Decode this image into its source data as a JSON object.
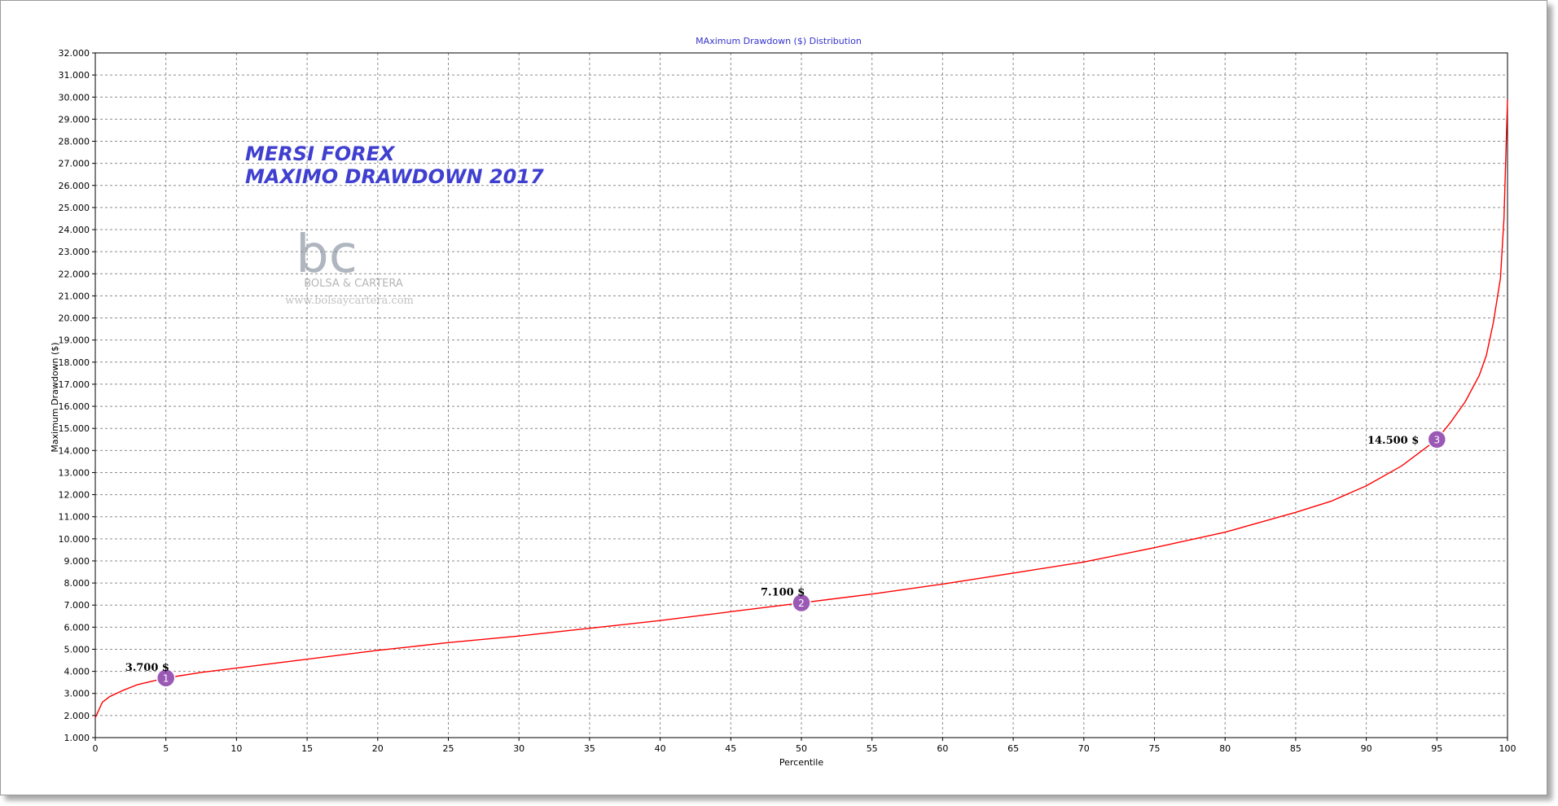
{
  "colors": {
    "line": "#ff0000",
    "title": "#3333cc",
    "overlay_text": "#3f3fd0",
    "marker": "#9b59b6",
    "grid": "#8c8c8c",
    "watermark": "#b0b6c0"
  },
  "chart_data": {
    "type": "line",
    "title": "MAximum Drawdown ($) Distribution",
    "xlabel": "Percentile",
    "ylabel": "Maximum Drawdown ($)",
    "xlim": [
      0,
      100
    ],
    "ylim": [
      1000,
      32000
    ],
    "x_ticks": [
      0,
      5,
      10,
      15,
      20,
      25,
      30,
      35,
      40,
      45,
      50,
      55,
      60,
      65,
      70,
      75,
      80,
      85,
      90,
      95,
      100
    ],
    "y_ticks": [
      1000,
      2000,
      3000,
      4000,
      5000,
      6000,
      7000,
      8000,
      9000,
      10000,
      11000,
      12000,
      13000,
      14000,
      15000,
      16000,
      17000,
      18000,
      19000,
      20000,
      21000,
      22000,
      23000,
      24000,
      25000,
      26000,
      27000,
      28000,
      29000,
      30000,
      31000,
      32000
    ],
    "y_tick_labels": [
      "1.000",
      "2.000",
      "3.000",
      "4.000",
      "5.000",
      "6.000",
      "7.000",
      "8.000",
      "9.000",
      "10.000",
      "11.000",
      "12.000",
      "13.000",
      "14.000",
      "15.000",
      "16.000",
      "17.000",
      "18.000",
      "19.000",
      "20.000",
      "21.000",
      "22.000",
      "23.000",
      "24.000",
      "25.000",
      "26.000",
      "27.000",
      "28.000",
      "29.000",
      "30.000",
      "31.000",
      "32.000"
    ],
    "grid": true,
    "series": [
      {
        "x": [
          0,
          0.5,
          1,
          2,
          3,
          4,
          5,
          7.5,
          10,
          15,
          20,
          25,
          30,
          35,
          40,
          45,
          50,
          55,
          60,
          65,
          70,
          75,
          80,
          85,
          87.5,
          90,
          92.5,
          95,
          96,
          97,
          98,
          98.5,
          99,
          99.5,
          99.75,
          100
        ],
        "y": [
          1900,
          2600,
          2850,
          3150,
          3400,
          3550,
          3700,
          3950,
          4150,
          4550,
          4950,
          5300,
          5600,
          5950,
          6300,
          6700,
          7100,
          7500,
          7950,
          8450,
          8950,
          9600,
          10300,
          11200,
          11700,
          12400,
          13300,
          14500,
          15300,
          16200,
          17400,
          18300,
          19800,
          21800,
          24500,
          29900
        ]
      }
    ],
    "annotations": [
      {
        "number": "1",
        "x": 5,
        "y": 3700,
        "label": "3.700 $"
      },
      {
        "number": "2",
        "x": 50,
        "y": 7100,
        "label": "7.100 $"
      },
      {
        "number": "3",
        "x": 95,
        "y": 14500,
        "label": "14.500 $"
      }
    ],
    "overlay_text": [
      "MERSI FOREX",
      "MAXIMO DRAWDOWN 2017"
    ],
    "watermark": {
      "text": "BOLSA & CARTERA",
      "url": "www.bolsaycartera.com"
    }
  }
}
